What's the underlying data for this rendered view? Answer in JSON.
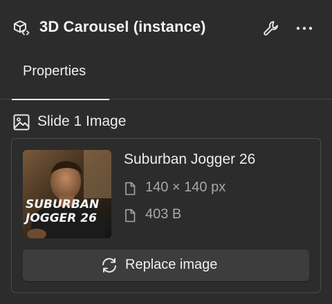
{
  "header": {
    "title": "3D Carousel (instance)",
    "component_icon": "component-instance-icon",
    "actions": [
      "wrench-icon",
      "more-horizontal-icon"
    ]
  },
  "tabs": [
    {
      "label": "Properties",
      "active": true
    }
  ],
  "section": {
    "title": "Slide 1 Image",
    "icon": "image-icon"
  },
  "image_card": {
    "thumbnail_text_line1": "SUBURBAN",
    "thumbnail_text_line2": "JOGGER 26",
    "file_name": "Suburban Jogger 26",
    "dimensions": "140 × 140 px",
    "file_size": "403 B",
    "meta_icon": "file-icon",
    "replace_button": {
      "label": "Replace image",
      "icon": "refresh-icon"
    }
  },
  "colors": {
    "background": "#2c2c2c",
    "border": "#4a4a4a",
    "button": "#3d3d3d",
    "text_primary": "#ececec",
    "text_secondary": "#a8a8a8"
  }
}
